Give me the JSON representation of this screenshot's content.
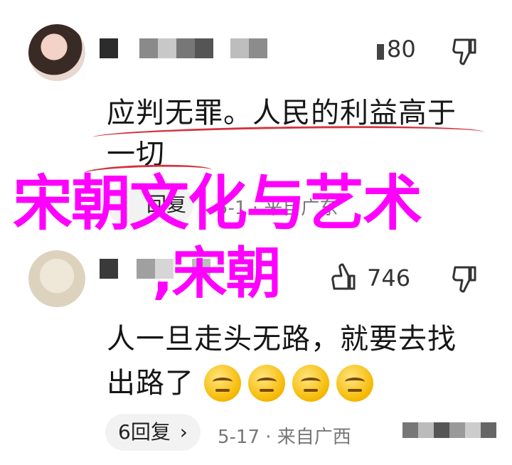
{
  "comment1": {
    "like_count": "80",
    "text_line1": "应判无罪。人民的利益高于",
    "text_line2": "一切",
    "reply_label": "回复",
    "meta_suffix": "5-1 · 来自广东"
  },
  "comment2": {
    "like_count": "746",
    "text_line1": "人一旦走头无路，就要去找",
    "text_line2": "出路了",
    "reply_label": "6回复",
    "reply_chevron": "›",
    "meta": "5-17 · 来自广西"
  },
  "overlay": {
    "title": "宋朝文化与艺术",
    "subtitle": ",宋朝"
  },
  "colors": {
    "overlay": "#ff00ff",
    "underline": "#d2343f"
  },
  "icons": [
    "thumbs-down-icon",
    "thumbs-up-icon",
    "chevron-right-icon",
    "smirk-emoji-icon"
  ]
}
